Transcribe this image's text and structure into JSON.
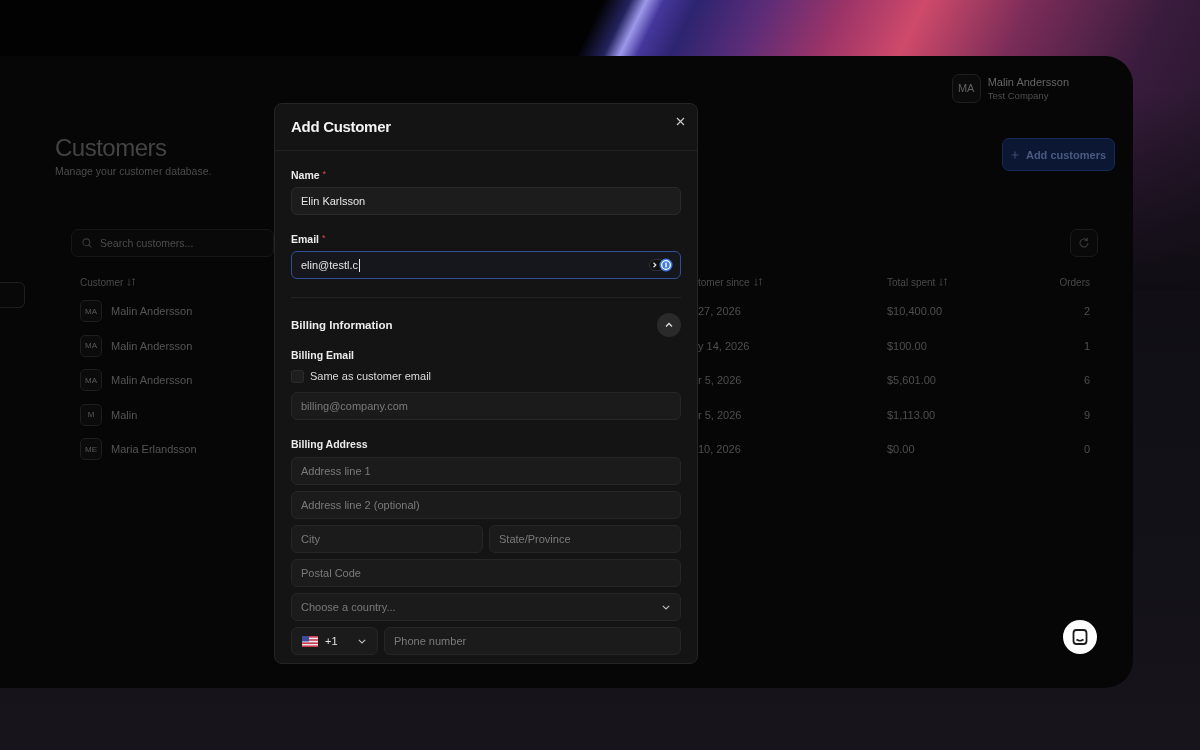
{
  "page": {
    "user": {
      "initials": "MA",
      "name": "Malin Andersson",
      "company": "Test Company"
    },
    "title": "Customers",
    "subtitle": "Manage your customer database.",
    "add_button": "Add customers",
    "search": {
      "placeholder": "Search customers..."
    },
    "table": {
      "columns": [
        {
          "label": "Customer",
          "sortable": true
        },
        {
          "label": "tomer since",
          "sortable": true
        },
        {
          "label": "Total spent",
          "sortable": true
        },
        {
          "label": "Orders",
          "sortable": false
        }
      ],
      "rows": [
        {
          "initials": "MA",
          "name": "Malin Andersson",
          "since": "27, 2026",
          "total": "$10,400.00",
          "orders": "2"
        },
        {
          "initials": "MA",
          "name": "Malin Andersson",
          "since": "y 14, 2026",
          "total": "$100.00",
          "orders": "1"
        },
        {
          "initials": "MA",
          "name": "Malin Andersson",
          "since": "r 5, 2026",
          "total": "$5,601.00",
          "orders": "6"
        },
        {
          "initials": "M",
          "name": "Malin",
          "since": "r 5, 2026",
          "total": "$1,113.00",
          "orders": "9"
        },
        {
          "initials": "ME",
          "name": "Maria Erlandsson",
          "since": "10, 2026",
          "total": "$0.00",
          "orders": "0"
        }
      ]
    }
  },
  "modal": {
    "title": "Add Customer",
    "fields": [
      {
        "kind": "name",
        "label": "Name",
        "required_mark": "*",
        "value": "Elin Karlsson",
        "focused": false
      },
      {
        "kind": "email",
        "label": "Email",
        "required_mark": "*",
        "value": "elin@testl.c",
        "focused": true
      }
    ],
    "billing": {
      "title": "Billing Information",
      "expanded": true,
      "email_label": "Billing Email",
      "same_as_customer": {
        "label": "Same as customer email",
        "checked": false
      },
      "email_placeholder": "billing@company.com",
      "address_label": "Billing Address",
      "address_rows": [
        {
          "fields": [
            {
              "placeholder": "Address line 1"
            }
          ]
        },
        {
          "fields": [
            {
              "placeholder": "Address line 2 (optional)"
            }
          ]
        },
        {
          "fields": [
            {
              "placeholder": "City"
            },
            {
              "placeholder": "State/Province"
            }
          ]
        },
        {
          "fields": [
            {
              "placeholder": "Postal Code"
            }
          ]
        }
      ],
      "country": {
        "placeholder": "Choose a country..."
      },
      "phone": {
        "dial_code": "+1",
        "placeholder": "Phone number"
      }
    }
  }
}
